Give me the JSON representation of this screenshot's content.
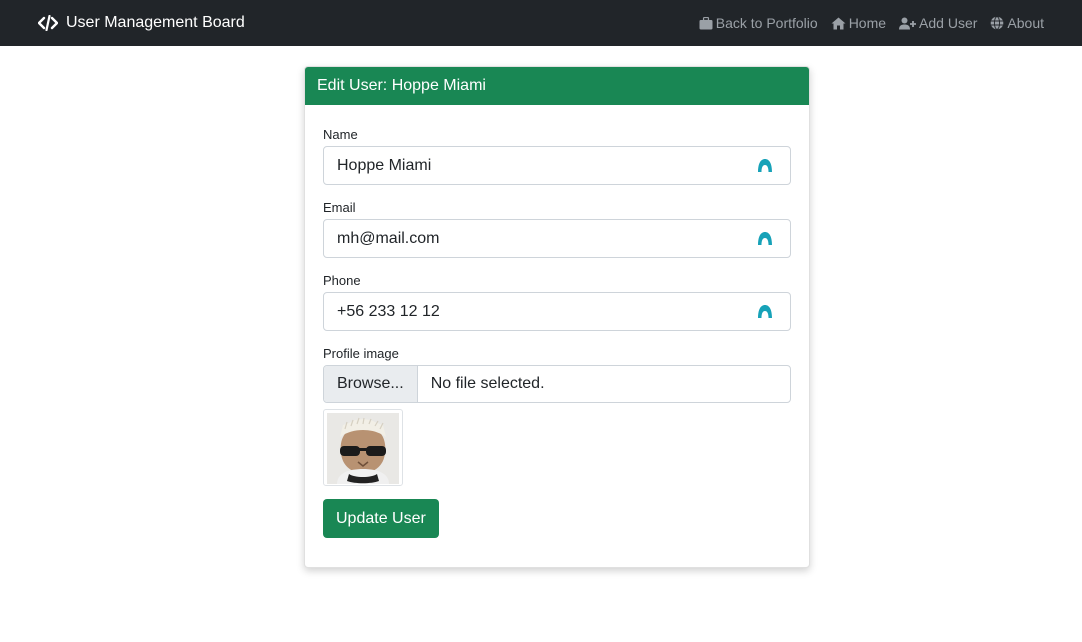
{
  "navbar": {
    "brand": "User Management Board",
    "links": [
      {
        "label": "Back to Portfolio",
        "icon": "briefcase-icon"
      },
      {
        "label": "Home",
        "icon": "home-icon"
      },
      {
        "label": "Add User",
        "icon": "user-plus-icon"
      },
      {
        "label": "About",
        "icon": "globe-icon"
      }
    ]
  },
  "card": {
    "title": "Edit User: Hoppe Miami",
    "fields": {
      "name": {
        "label": "Name",
        "value": "Hoppe Miami"
      },
      "email": {
        "label": "Email",
        "value": "mh@mail.com"
      },
      "phone": {
        "label": "Phone",
        "value": "+56 233 12 12"
      }
    },
    "profile_image": {
      "label": "Profile image",
      "browse_label": "Browse...",
      "file_status": "No file selected."
    },
    "submit_label": "Update User"
  },
  "colors": {
    "navbar_bg": "#212529",
    "accent": "#198754",
    "extension_icon": "#17a2b8"
  }
}
